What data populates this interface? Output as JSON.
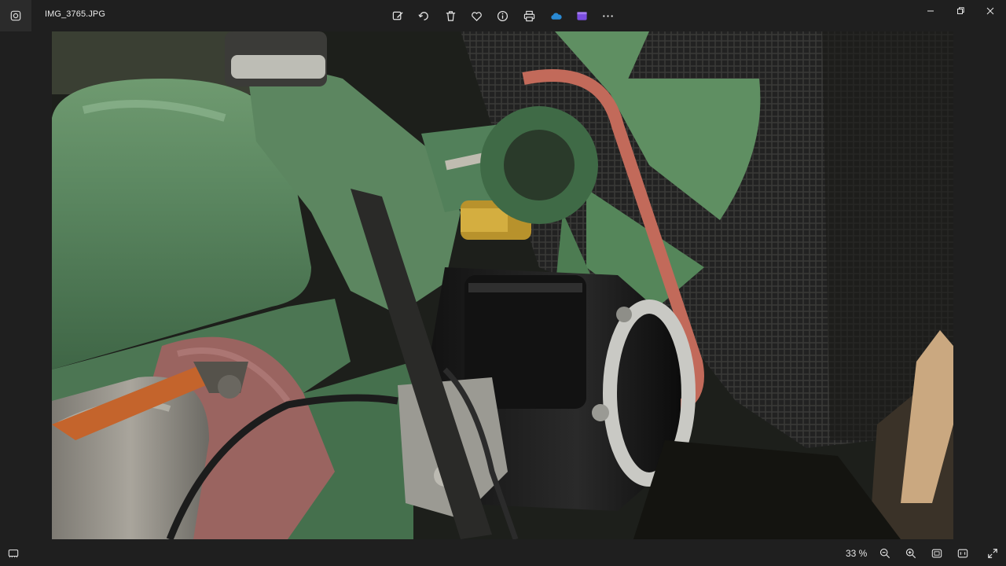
{
  "window": {
    "file_name": "IMG_3765.JPG"
  },
  "toolbar": {
    "items": [
      {
        "icon": "edit-image-icon"
      },
      {
        "icon": "rotate-icon"
      },
      {
        "icon": "delete-icon"
      },
      {
        "icon": "favorite-heart-icon"
      },
      {
        "icon": "info-icon"
      },
      {
        "icon": "print-icon"
      },
      {
        "icon": "onedrive-cloud-icon"
      },
      {
        "icon": "clipchamp-icon"
      },
      {
        "icon": "more-options-icon"
      }
    ],
    "accent_colors": {
      "onedrive": "#2a8ad4",
      "clipchamp": "#7b4de0"
    }
  },
  "window_controls": [
    "minimize-icon",
    "maximize-icon",
    "close-icon"
  ],
  "photo": {
    "description_icon": "engine-photo",
    "dominant_colors": [
      "#56805a",
      "#1a1a1a",
      "#b35a4a",
      "#8a8a86"
    ]
  },
  "statusbar": {
    "zoom": "33 %",
    "zoom_value_percent": 33,
    "icons": [
      "filmstrip-icon",
      "zoom-out-icon",
      "zoom-in-icon",
      "fit-to-window-icon",
      "actual-size-icon",
      "fullscreen-icon"
    ]
  }
}
